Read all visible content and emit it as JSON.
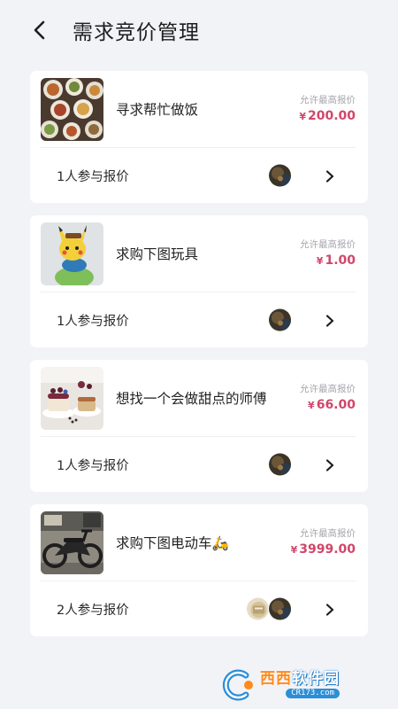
{
  "header": {
    "title": "需求竞价管理",
    "back_icon": "chevron-left-icon"
  },
  "demands": [
    {
      "title": "寻求帮忙做饭",
      "price_caption": "允许最高报价",
      "currency": "¥",
      "price": "200.00",
      "bidders_text": "1人参与报价",
      "thumbnail": "food-dishes-photo",
      "avatar_count": 1
    },
    {
      "title": "求购下图玩具",
      "price_caption": "允许最高报价",
      "currency": "¥",
      "price": "1.00",
      "bidders_text": "1人参与报价",
      "thumbnail": "toy-figure-photo",
      "avatar_count": 1
    },
    {
      "title": "想找一个会做甜点的师傅",
      "price_caption": "允许最高报价",
      "currency": "¥",
      "price": "66.00",
      "bidders_text": "1人参与报价",
      "thumbnail": "dessert-photo",
      "avatar_count": 1
    },
    {
      "title": "求购下图电动车🛵",
      "price_caption": "允许最高报价",
      "currency": "¥",
      "price": "3999.00",
      "bidders_text": "2人参与报价",
      "thumbnail": "electric-bike-photo",
      "avatar_count": 2
    }
  ],
  "colors": {
    "price": "#d0476a",
    "background": "#f2f3f7",
    "card": "#ffffff"
  },
  "watermark": {
    "main_a": "西西",
    "main_b": "软件园",
    "sub": "CR173.com"
  }
}
